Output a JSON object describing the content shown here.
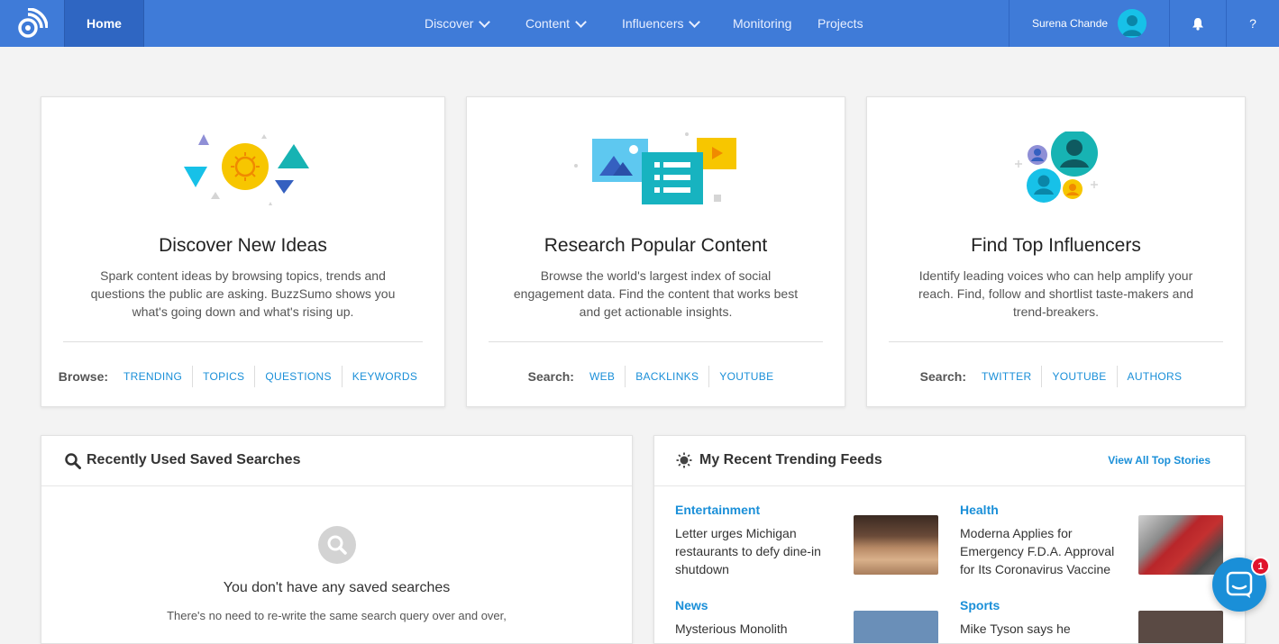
{
  "nav": {
    "home": "Home",
    "items": [
      {
        "label": "Discover",
        "dropdown": true
      },
      {
        "label": "Content",
        "dropdown": true
      },
      {
        "label": "Influencers",
        "dropdown": true
      },
      {
        "label": "Monitoring",
        "dropdown": false
      },
      {
        "label": "Projects",
        "dropdown": false
      }
    ],
    "user_name": "Surena Chande",
    "help": "?"
  },
  "cards": [
    {
      "title": "Discover New Ideas",
      "description": "Spark content ideas by browsing topics, trends and questions the public are asking. BuzzSumo shows you what's going down and what's rising up.",
      "links_label": "Browse:",
      "links": [
        "TRENDING",
        "TOPICS",
        "QUESTIONS",
        "KEYWORDS"
      ]
    },
    {
      "title": "Research Popular Content",
      "description": "Browse the world's largest index of social engagement data. Find the content that works best and get actionable insights.",
      "links_label": "Search:",
      "links": [
        "WEB",
        "BACKLINKS",
        "YOUTUBE"
      ]
    },
    {
      "title": "Find Top Influencers",
      "description": "Identify leading voices who can help amplify your reach. Find, follow and shortlist taste-makers and trend-breakers.",
      "links_label": "Search:",
      "links": [
        "TWITTER",
        "YOUTUBE",
        "AUTHORS"
      ]
    }
  ],
  "saved_searches": {
    "title": "Recently Used Saved Searches",
    "empty_title": "You don't have any saved searches",
    "empty_desc": "There's no need to re-write the same search query over and over,"
  },
  "trending": {
    "title": "My Recent Trending Feeds",
    "view_all": "View All Top Stories",
    "feeds": [
      {
        "category": "Entertainment",
        "headline": "Letter urges Michigan restaurants to defy dine-in shutdown"
      },
      {
        "category": "Health",
        "headline": "Moderna Applies for Emergency F.D.A. Approval for Its Coronavirus Vaccine"
      },
      {
        "category": "News",
        "headline": "Mysterious Monolith"
      },
      {
        "category": "Sports",
        "headline": "Mike Tyson says he"
      }
    ]
  },
  "chat_badge": "1",
  "colors": {
    "nav_bg": "#3f7bd8",
    "link": "#1a8fd8",
    "badge": "#e0142c"
  }
}
